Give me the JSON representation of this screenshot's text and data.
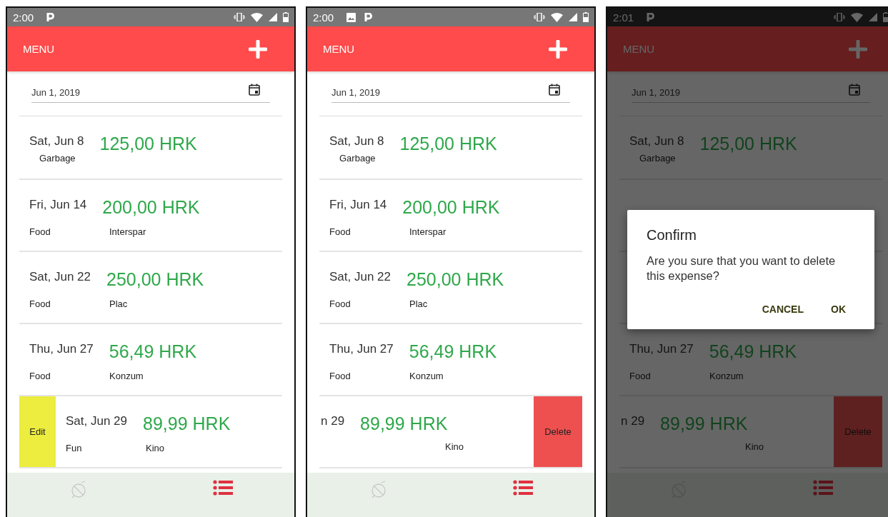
{
  "phones": [
    {
      "status_bar": {
        "time": "2:00",
        "notifications": [
          {
            "kind": "parking"
          }
        ]
      },
      "header": {
        "menu": "MENU"
      },
      "date_field": {
        "value": "Jun 1, 2019"
      },
      "dimmed": false,
      "expenses": [
        {
          "date": "Sat, Jun 8",
          "amount": "125,00 HRK",
          "category": "Garbage"
        },
        {
          "date": "Fri, Jun 14",
          "amount": "200,00 HRK",
          "category": "Food",
          "place": "Interspar"
        },
        {
          "date": "Sat, Jun 22",
          "amount": "250,00 HRK",
          "category": "Food",
          "place": "Plac"
        },
        {
          "date": "Thu, Jun 27",
          "amount": "56,49 HRK",
          "category": "Food",
          "place": "Konzum"
        },
        {
          "date": "Sat, Jun 29",
          "amount": "89,99 HRK",
          "category": "Fun",
          "place": "Kino",
          "action": {
            "kind": "edit",
            "label": "Edit"
          }
        }
      ],
      "nav": [
        {
          "kind": "stats",
          "selected": false
        },
        {
          "kind": "list",
          "selected": true
        }
      ]
    },
    {
      "status_bar": {
        "time": "2:00",
        "notifications": [
          {
            "kind": "image"
          },
          {
            "kind": "parking"
          }
        ]
      },
      "header": {
        "menu": "MENU"
      },
      "date_field": {
        "value": "Jun 1, 2019"
      },
      "dimmed": false,
      "expenses": [
        {
          "date": "Sat, Jun 8",
          "amount": "125,00 HRK",
          "category": "Garbage"
        },
        {
          "date": "Fri, Jun 14",
          "amount": "200,00 HRK",
          "category": "Food",
          "place": "Interspar"
        },
        {
          "date": "Sat, Jun 22",
          "amount": "250,00 HRK",
          "category": "Food",
          "place": "Plac"
        },
        {
          "date": "Thu, Jun 27",
          "amount": "56,49 HRK",
          "category": "Food",
          "place": "Konzum"
        },
        {
          "date": "n 29",
          "amount": "89,99 HRK",
          "place": "Kino",
          "action": {
            "kind": "delete",
            "label": "Delete"
          }
        }
      ],
      "nav": [
        {
          "kind": "stats",
          "selected": false
        },
        {
          "kind": "list",
          "selected": true
        }
      ]
    },
    {
      "status_bar": {
        "time": "2:01",
        "notifications": [
          {
            "kind": "parking"
          }
        ]
      },
      "header": {
        "menu": "MENU"
      },
      "date_field": {
        "value": "Jun 1, 2019"
      },
      "dimmed": true,
      "expenses": [
        {
          "date": "Sat, Jun 8",
          "amount": "125,00 HRK",
          "category": "Garbage"
        },
        {
          "covered": true
        },
        {
          "covered": true
        },
        {
          "date": "Thu, Jun 27",
          "amount": "56,49 HRK",
          "category": "Food",
          "place": "Konzum"
        },
        {
          "date": "n 29",
          "amount": "89,99 HRK",
          "place": "Kino",
          "action": {
            "kind": "delete",
            "label": "Delete"
          }
        }
      ],
      "nav": [
        {
          "kind": "stats",
          "selected": false
        },
        {
          "kind": "list",
          "selected": true
        }
      ],
      "dialog": {
        "title": "Confirm",
        "message": "Are you sure that you want to delete this expense?",
        "buttons": [
          "CANCEL",
          "OK"
        ]
      }
    }
  ]
}
